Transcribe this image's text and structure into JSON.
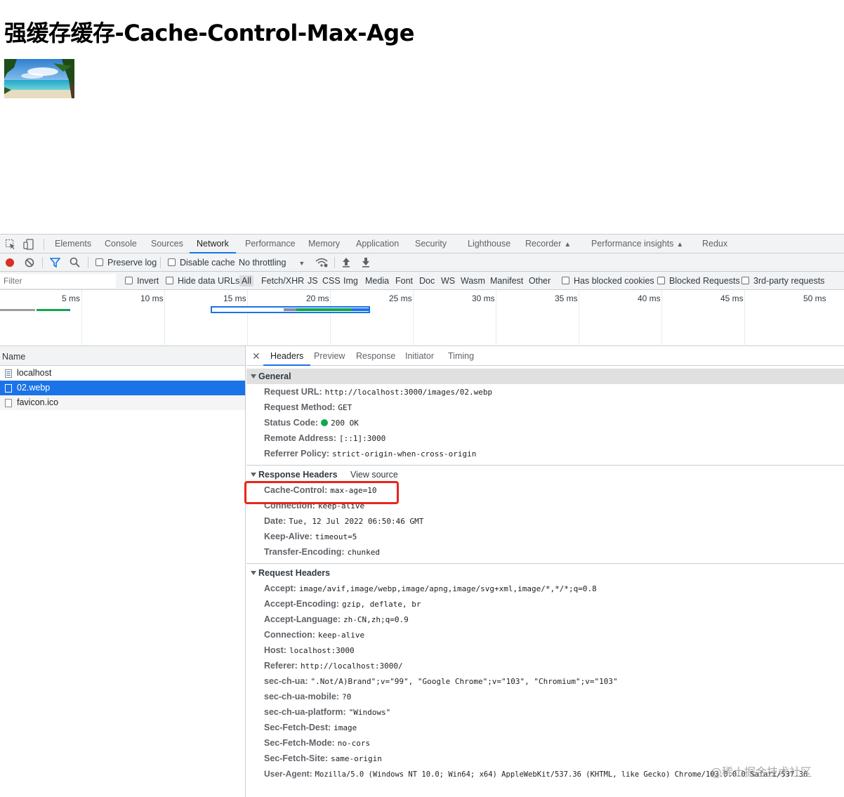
{
  "page": {
    "title": "强缓存缓存-Cache-Control-Max-Age"
  },
  "devtools": {
    "panel_tabs": [
      {
        "label": "Elements"
      },
      {
        "label": "Console"
      },
      {
        "label": "Sources"
      },
      {
        "label": "Network"
      },
      {
        "label": "Performance"
      },
      {
        "label": "Memory"
      },
      {
        "label": "Application"
      },
      {
        "label": "Security"
      },
      {
        "label": "Lighthouse"
      },
      {
        "label": "Recorder"
      },
      {
        "label": "Performance insights"
      },
      {
        "label": "Redux"
      }
    ],
    "toolbar": {
      "preserve_log": "Preserve log",
      "disable_cache": "Disable cache",
      "throttling": "No throttling"
    },
    "filterbar": {
      "filter_placeholder": "Filter",
      "invert": "Invert",
      "hide_data_urls": "Hide data URLs",
      "types": [
        "All",
        "Fetch/XHR",
        "JS",
        "CSS",
        "Img",
        "Media",
        "Font",
        "Doc",
        "WS",
        "Wasm",
        "Manifest",
        "Other"
      ],
      "has_blocked_cookies": "Has blocked cookies",
      "blocked_requests": "Blocked Requests",
      "third_party": "3rd-party requests"
    },
    "timeline_labels": [
      "5 ms",
      "10 ms",
      "15 ms",
      "20 ms",
      "25 ms",
      "30 ms",
      "35 ms",
      "40 ms",
      "45 ms",
      "50 ms"
    ],
    "requests": {
      "header": "Name",
      "items": [
        {
          "name": "localhost"
        },
        {
          "name": "02.webp"
        },
        {
          "name": "favicon.ico"
        }
      ]
    },
    "detail_tabs": [
      "Headers",
      "Preview",
      "Response",
      "Initiator",
      "Timing"
    ],
    "general": {
      "title": "General",
      "rows": [
        {
          "key": "Request URL:",
          "value": "http://localhost:3000/images/02.webp"
        },
        {
          "key": "Request Method:",
          "value": "GET"
        },
        {
          "key": "Status Code:",
          "value": "200 OK"
        },
        {
          "key": "Remote Address:",
          "value": "[::1]:3000"
        },
        {
          "key": "Referrer Policy:",
          "value": "strict-origin-when-cross-origin"
        }
      ]
    },
    "response_headers": {
      "title": "Response Headers",
      "view_source": "View source",
      "rows": [
        {
          "key": "Cache-Control:",
          "value": "max-age=10"
        },
        {
          "key": "Connection:",
          "value": "keep-alive"
        },
        {
          "key": "Date:",
          "value": "Tue, 12 Jul 2022 06:50:46 GMT"
        },
        {
          "key": "Keep-Alive:",
          "value": "timeout=5"
        },
        {
          "key": "Transfer-Encoding:",
          "value": "chunked"
        }
      ]
    },
    "request_headers": {
      "title": "Request Headers",
      "rows": [
        {
          "key": "Accept:",
          "value": "image/avif,image/webp,image/apng,image/svg+xml,image/*,*/*;q=0.8"
        },
        {
          "key": "Accept-Encoding:",
          "value": "gzip, deflate, br"
        },
        {
          "key": "Accept-Language:",
          "value": "zh-CN,zh;q=0.9"
        },
        {
          "key": "Connection:",
          "value": "keep-alive"
        },
        {
          "key": "Host:",
          "value": "localhost:3000"
        },
        {
          "key": "Referer:",
          "value": "http://localhost:3000/"
        },
        {
          "key": "sec-ch-ua:",
          "value": "\".Not/A)Brand\";v=\"99\", \"Google Chrome\";v=\"103\", \"Chromium\";v=\"103\""
        },
        {
          "key": "sec-ch-ua-mobile:",
          "value": "?0"
        },
        {
          "key": "sec-ch-ua-platform:",
          "value": "\"Windows\""
        },
        {
          "key": "Sec-Fetch-Dest:",
          "value": "image"
        },
        {
          "key": "Sec-Fetch-Mode:",
          "value": "no-cors"
        },
        {
          "key": "Sec-Fetch-Site:",
          "value": "same-origin"
        },
        {
          "key": "User-Agent:",
          "value": "Mozilla/5.0 (Windows NT 10.0; Win64; x64) AppleWebKit/537.36 (KHTML, like Gecko) Chrome/103.0.0.0 Safari/537.36"
        }
      ]
    }
  },
  "watermark": "@稀土掘金技术社区",
  "colors": {
    "accent": "#1a73e8",
    "highlight": "#e8251c",
    "status_ok": "#0fa84b",
    "record": "#d93025"
  }
}
